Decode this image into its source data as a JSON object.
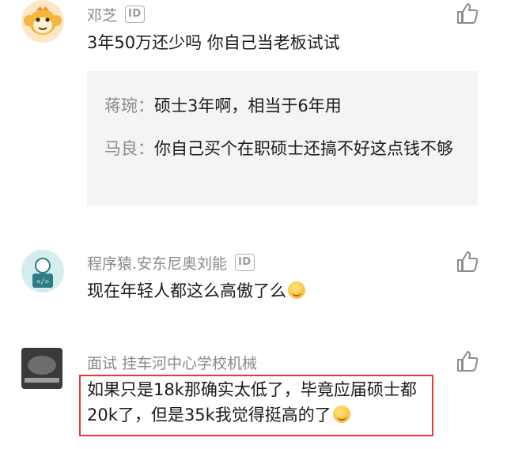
{
  "comments": [
    {
      "name": "邓芝",
      "badge": "ID",
      "text": "3年50万还少吗 你自己当老板试试",
      "replies": [
        {
          "name": "蒋琬：",
          "text": "硕士3年啊，相当于6年用"
        },
        {
          "name": "马良：",
          "text": "你自己买个在职硕士还搞不好这点钱不够"
        }
      ]
    },
    {
      "name": "程序猿.安东尼奥刘能",
      "badge": "ID",
      "text": "现在年轻人都这么高傲了么",
      "avatar_text": "</>"
    },
    {
      "name": "面试 挂车河中心学校机械",
      "text": "如果只是18k那确实太低了，毕竟应届硕士都20k了，但是35k我觉得挺高的了"
    }
  ],
  "colors": {
    "highlight_border": "#e53935",
    "quote_bg": "#f4f4f5",
    "name_gray": "#8a8a8a"
  },
  "icons": [
    "monkey-avatar",
    "coder-avatar",
    "photo-avatar",
    "thumbs-up-icon",
    "emoji-icon"
  ]
}
